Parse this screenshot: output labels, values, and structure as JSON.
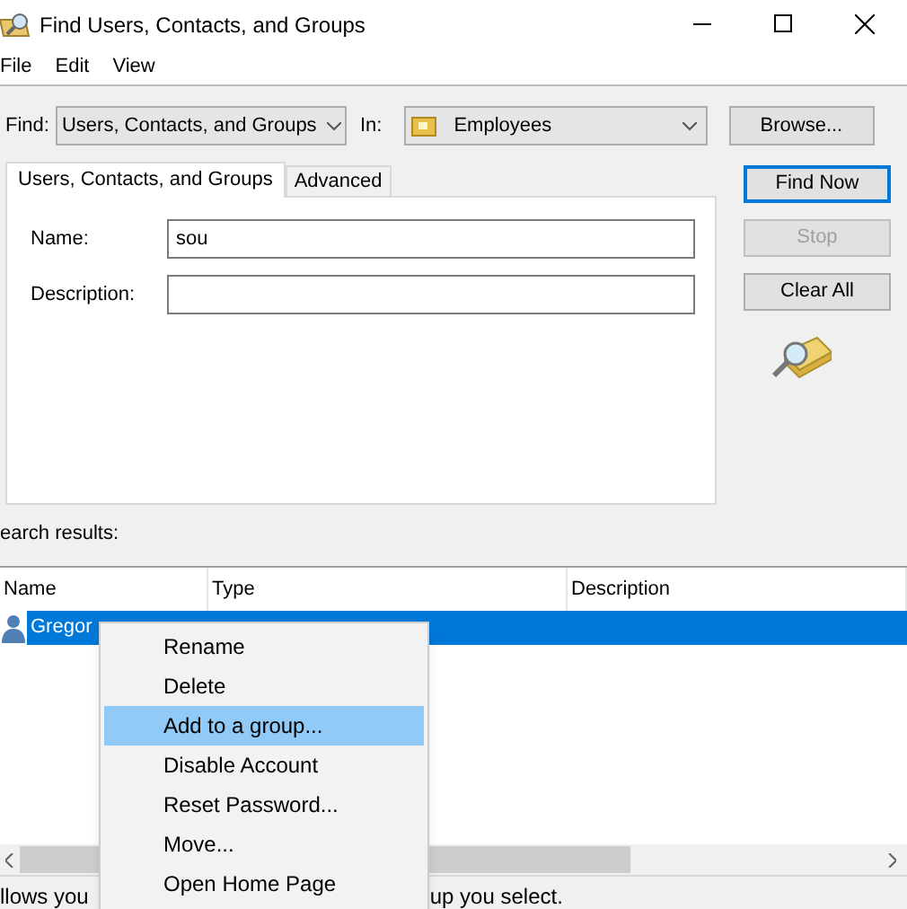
{
  "window": {
    "title": "Find Users, Contacts, and Groups"
  },
  "menu_bar": [
    "File",
    "Edit",
    "View"
  ],
  "find": {
    "label": "Find:",
    "value": "Users, Contacts, and Groups"
  },
  "in": {
    "label": "In:",
    "value": "Employees"
  },
  "browse_button": "Browse...",
  "tabs": [
    {
      "label": "Users, Contacts, and Groups",
      "selected": true
    },
    {
      "label": "Advanced",
      "selected": false
    }
  ],
  "fields": [
    {
      "label": "Name:",
      "value": "sou"
    },
    {
      "label": "Description:"
    }
  ],
  "buttons": [
    {
      "label": "Find Now",
      "disabled": false,
      "default": true
    },
    {
      "label": "Stop",
      "disabled": true,
      "default": false
    },
    {
      "label": "Clear All",
      "disabled": false,
      "default": false
    }
  ],
  "results_label": "earch results:",
  "table": {
    "columns": [
      "Name",
      "Type",
      "Description"
    ],
    "rows": [
      {
        "name": "Gregor",
        "selected": true
      }
    ]
  },
  "context_menu": [
    {
      "label": "Rename",
      "selected": false
    },
    {
      "label": "Delete",
      "selected": false
    },
    {
      "label": "Add to a group...",
      "selected": true
    },
    {
      "label": "Disable Account",
      "selected": false
    },
    {
      "label": "Reset Password...",
      "selected": false
    },
    {
      "label": "Move...",
      "selected": false
    },
    {
      "label": "Open Home Page",
      "selected": false
    }
  ],
  "status_bar": [
    "llows you",
    "up you select."
  ]
}
